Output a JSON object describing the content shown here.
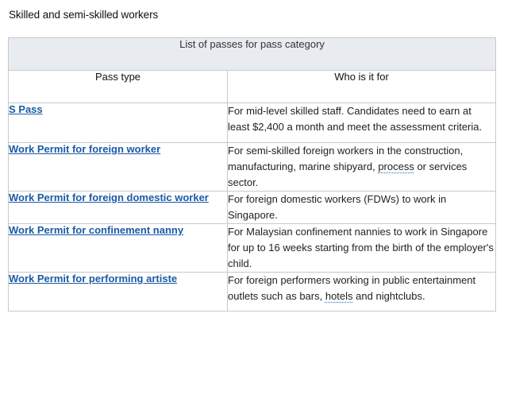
{
  "page_heading": "Skilled and semi-skilled workers",
  "table": {
    "caption": "List of passes for pass category",
    "headers": {
      "pass_type": "Pass type",
      "who": "Who is it for"
    },
    "rows": [
      {
        "pass": "S Pass",
        "desc": "For mid-level skilled staff. Candidates need to earn at least $2,400 a month and meet the assessment criteria."
      },
      {
        "pass": "Work Permit for foreign worker",
        "desc_before": "For semi-skilled foreign workers in the construction, manufacturing, marine shipyard, ",
        "desc_mark": "process",
        "desc_after": " or services sector."
      },
      {
        "pass": "Work Permit for foreign domestic worker",
        "desc": "For foreign domestic workers (FDWs) to work in Singapore."
      },
      {
        "pass": "Work Permit for confinement nanny",
        "desc": "For Malaysian confinement nannies to work in Singapore for up to 16 weeks starting from the birth of the employer's child."
      },
      {
        "pass": "Work Permit for performing artiste",
        "desc_before": "For foreign performers working in public entertainment outlets such as bars, ",
        "desc_mark": "hotels",
        "desc_after": " and nightclubs."
      }
    ]
  }
}
